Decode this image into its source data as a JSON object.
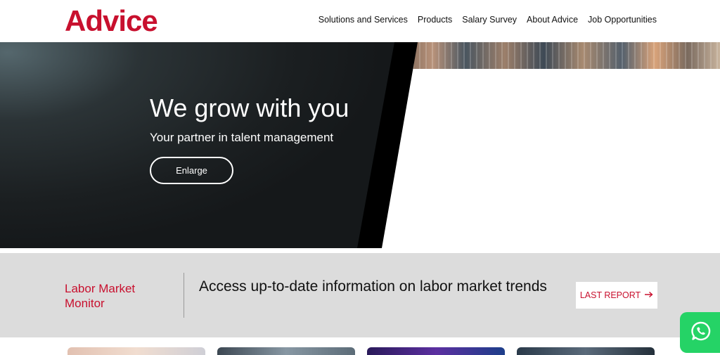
{
  "brand": {
    "logo_text": "Advice",
    "accent": "#c8102e"
  },
  "nav": {
    "items": [
      {
        "label": "Solutions and Services"
      },
      {
        "label": "Products"
      },
      {
        "label": "Salary Survey"
      },
      {
        "label": "About Advice"
      },
      {
        "label": "Job Opportunities"
      }
    ]
  },
  "hero": {
    "title": "We grow with you",
    "subtitle": "Your partner in talent management",
    "button_label": "Enlarge"
  },
  "monitor": {
    "label": "Labor Market Monitor",
    "text": "Access up-to-date information on labor market trends",
    "button_label": "LAST REPORT",
    "button_icon": "arrow-right-icon",
    "background": "#dcdcdc"
  },
  "floating": {
    "icon": "whatsapp-icon",
    "color": "#25d366"
  }
}
